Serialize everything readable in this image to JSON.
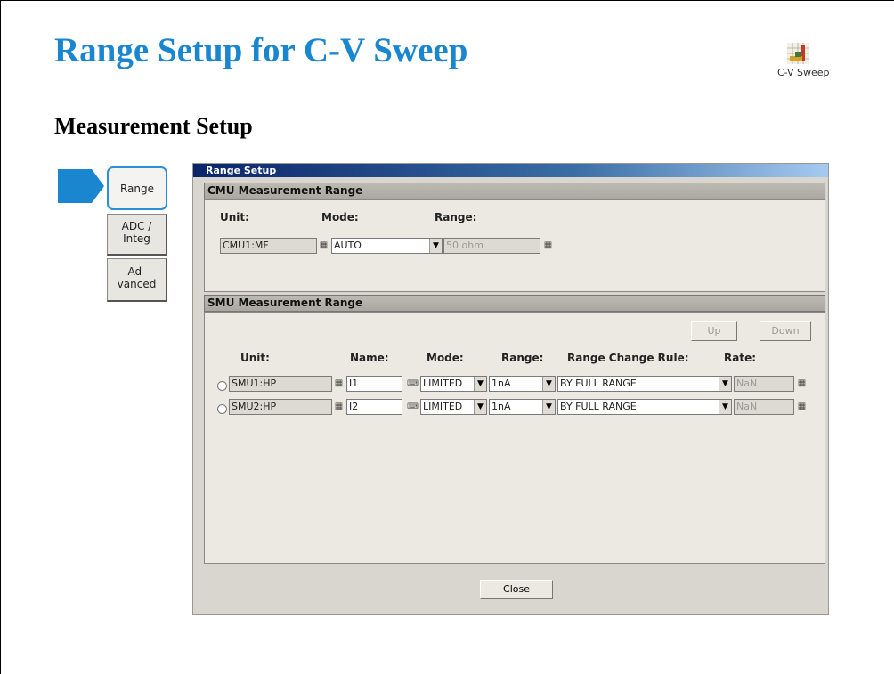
{
  "slide": {
    "title": "Range Setup for C-V Sweep",
    "subtitle": "Measurement Setup",
    "icon": {
      "name": "cv-sweep-icon",
      "label": "C-V Sweep"
    }
  },
  "side_tabs": [
    {
      "label": "Range",
      "active": true
    },
    {
      "label": "ADC /\nInteg",
      "active": false
    },
    {
      "label": "Ad-\nvanced",
      "active": false
    }
  ],
  "window": {
    "title": "Range Setup",
    "cmu": {
      "header": "CMU Measurement Range",
      "col_unit": "Unit:",
      "col_mode": "Mode:",
      "col_range": "Range:",
      "unit_value": "CMU1:MF",
      "mode_value": "AUTO",
      "range_value": "50 ohm"
    },
    "smu": {
      "header": "SMU Measurement Range",
      "up_label": "Up",
      "down_label": "Down",
      "columns": [
        "Unit:",
        "Name:",
        "Mode:",
        "Range:",
        "Range Change Rule:",
        "Rate:"
      ],
      "rows": [
        {
          "unit": "SMU1:HP",
          "name": "I1",
          "mode": "LIMITED",
          "range": "1nA",
          "rule": "BY FULL RANGE",
          "rate": "NaN"
        },
        {
          "unit": "SMU2:HP",
          "name": "I2",
          "mode": "LIMITED",
          "range": "1nA",
          "rule": "BY FULL RANGE",
          "rate": "NaN"
        }
      ]
    },
    "close_label": "Close"
  },
  "colors": {
    "title_blue": "#1a86d0",
    "tab_highlight": "#2d8fd8",
    "arrow_blue": "#1a86d0"
  }
}
